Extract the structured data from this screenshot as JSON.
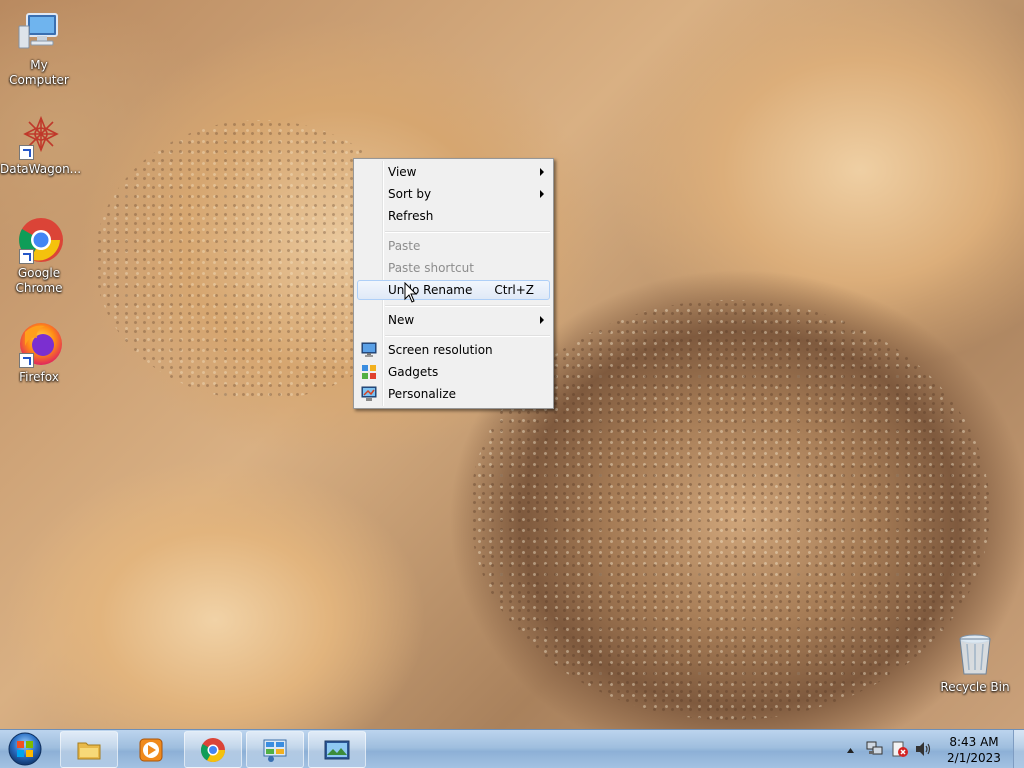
{
  "desktop": {
    "icons": [
      {
        "label": "My Computer"
      },
      {
        "label": "DataWagon..."
      },
      {
        "label": "Google Chrome"
      },
      {
        "label": "Firefox"
      },
      {
        "label": "Recycle Bin"
      }
    ]
  },
  "context_menu": {
    "items": {
      "view": {
        "label": "View",
        "submenu": true
      },
      "sort_by": {
        "label": "Sort by",
        "submenu": true
      },
      "refresh": {
        "label": "Refresh"
      },
      "paste": {
        "label": "Paste",
        "disabled": true
      },
      "paste_shortcut": {
        "label": "Paste shortcut",
        "disabled": true
      },
      "undo_rename": {
        "label": "Undo Rename",
        "shortcut": "Ctrl+Z",
        "highlighted": true
      },
      "new": {
        "label": "New",
        "submenu": true
      },
      "screen_resolution": {
        "label": "Screen resolution",
        "icon": "monitor-icon"
      },
      "gadgets": {
        "label": "Gadgets",
        "icon": "gadgets-icon"
      },
      "personalize": {
        "label": "Personalize",
        "icon": "personalize-icon"
      }
    }
  },
  "taskbar": {
    "pinned": [
      {
        "icon": "file-explorer-icon"
      },
      {
        "icon": "media-player-icon"
      },
      {
        "icon": "chrome-icon"
      },
      {
        "icon": "control-panel-icon"
      },
      {
        "icon": "picture-viewer-icon"
      }
    ],
    "clock": {
      "time": "8:43 AM",
      "date": "2/1/2023"
    }
  },
  "colors": {
    "menu_bg": "#f0f0f0",
    "menu_highlight": "#dfe9f7",
    "taskbar": "#9fbede"
  }
}
